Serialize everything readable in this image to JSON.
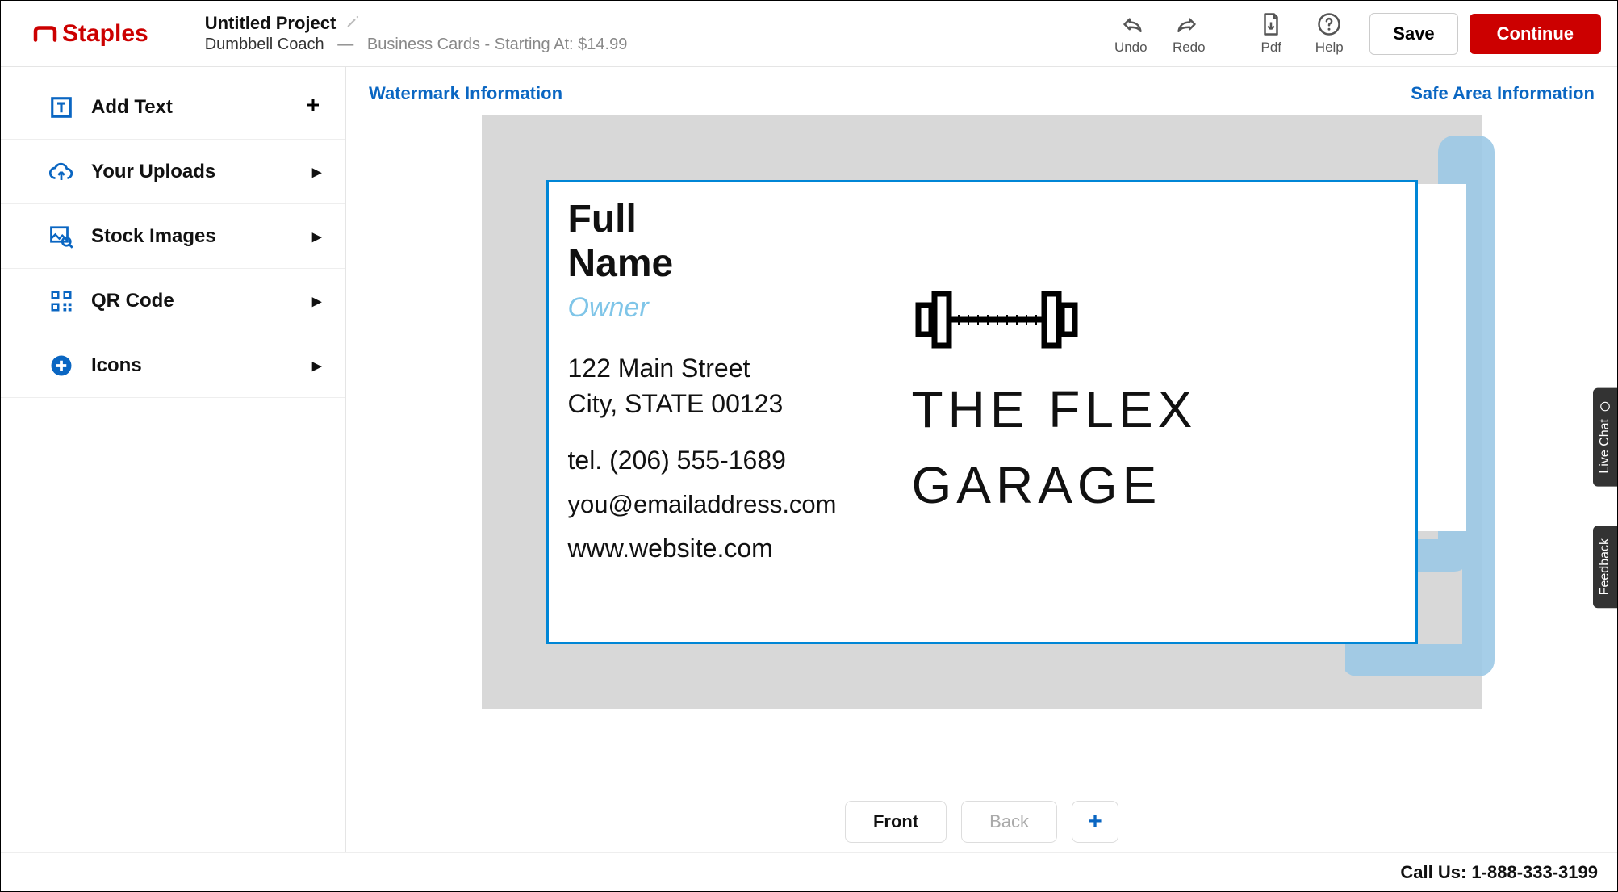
{
  "brand": "Staples",
  "header": {
    "project_title": "Untitled Project",
    "template_name": "Dumbbell Coach",
    "separator": "—",
    "product_line": "Business Cards - Starting At: $14.99",
    "undo": "Undo",
    "redo": "Redo",
    "pdf": "Pdf",
    "help": "Help",
    "save": "Save",
    "continue": "Continue"
  },
  "sidebar": {
    "items": [
      {
        "label": "Add Text"
      },
      {
        "label": "Your Uploads"
      },
      {
        "label": "Stock Images"
      },
      {
        "label": "QR Code"
      },
      {
        "label": "Icons"
      }
    ]
  },
  "info": {
    "watermark": "Watermark Information",
    "safe_area": "Safe Area Information"
  },
  "card": {
    "name_line1": "Full",
    "name_line2": "Name",
    "role": "Owner",
    "addr_line1": "122 Main Street",
    "addr_line2": "City, STATE 00123",
    "tel": "tel. (206) 555-1689",
    "email": "you@emailaddress.com",
    "web": "www.website.com",
    "brand_line1": "THE FLEX",
    "brand_line2": "GARAGE"
  },
  "tabs": {
    "front": "Front",
    "back": "Back",
    "add": "+"
  },
  "footer": {
    "call_us": "Call Us: 1-888-333-3199"
  },
  "side_tabs": {
    "chat": "Live Chat",
    "feedback": "Feedback"
  }
}
